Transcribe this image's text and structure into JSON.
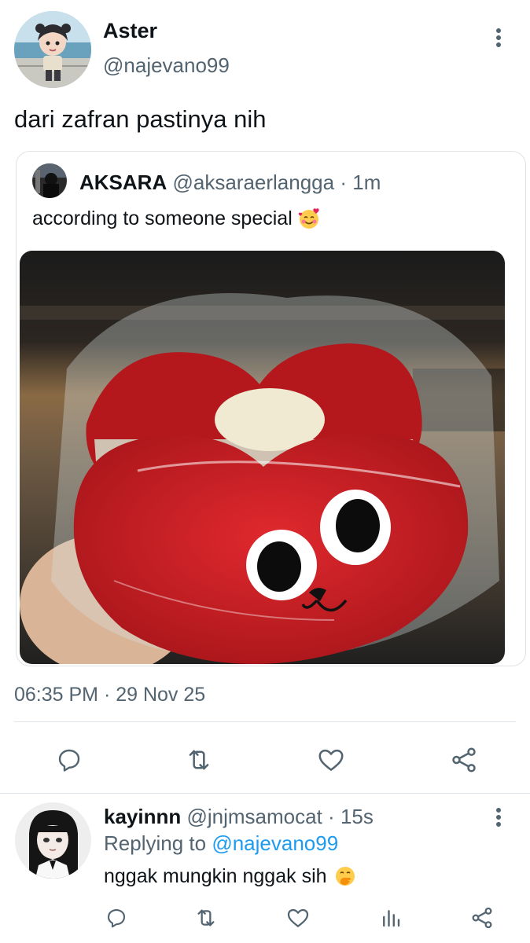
{
  "main_tweet": {
    "author_name": "Aster",
    "author_handle": "@najevano99",
    "text": "dari zafran pastinya nih",
    "timestamp": "06:35 PM · 29 Nov 25"
  },
  "quote_tweet": {
    "author_name": "AKSARA",
    "author_handle": "@aksaraerlangga",
    "separator": "·",
    "time_ago": "1m",
    "text": "according to someone special",
    "emoji": "smiling-face-with-hearts",
    "image_subject": "red heart-shaped macaron with cartoon face in plastic wrap"
  },
  "reply": {
    "author_name": "kayinnn",
    "author_handle": "@jnjmsamocat",
    "separator": "·",
    "time_ago": "15s",
    "replying_prefix": "Replying to",
    "replying_to": "@najevano99",
    "text": "nggak mungkin nggak sih",
    "emoji": "face-with-hand-over-mouth"
  },
  "colors": {
    "text_primary": "#0f1419",
    "text_secondary": "#536471",
    "link": "#1d9bf0",
    "border": "#dfe3e6",
    "icon": "#536471"
  },
  "icons": {
    "more": "vertical-dots-icon",
    "reply": "speech-bubble-icon",
    "retweet": "retweet-icon",
    "like": "heart-icon",
    "share": "share-icon",
    "views": "bar-chart-icon"
  }
}
